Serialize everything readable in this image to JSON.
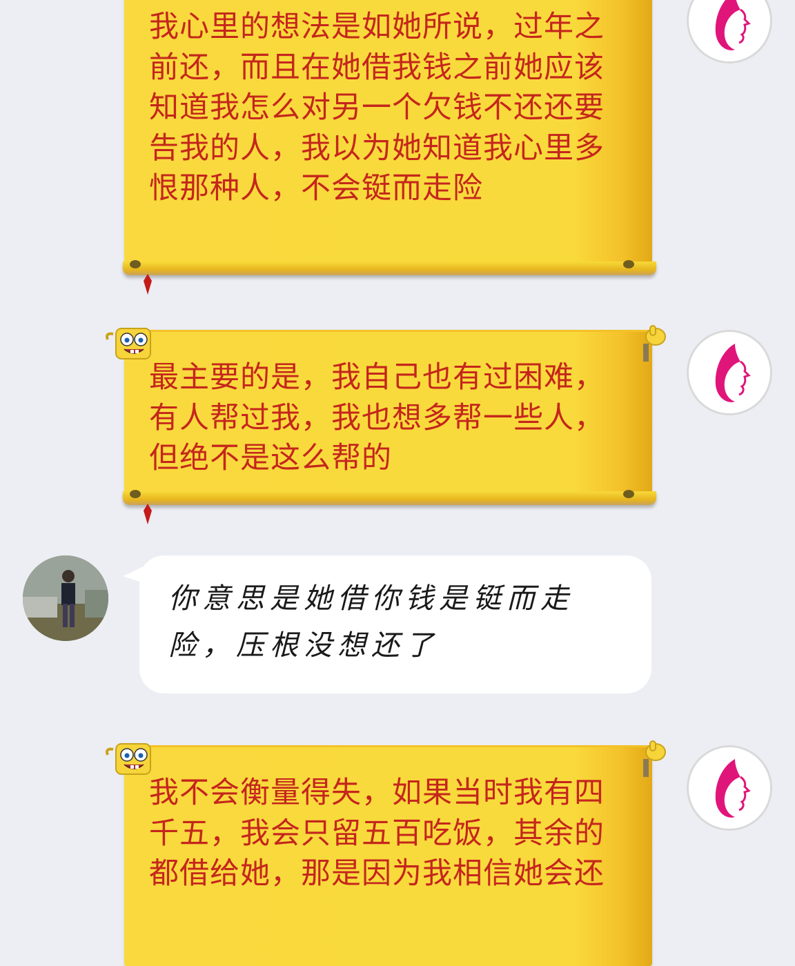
{
  "chat": {
    "messages": [
      {
        "sender": "self",
        "text": "我心里的想法是如她所说，过年之前还，而且在她借我钱之前她应该知道我怎么对另一个欠钱不还还要告我的人，我以为她知道我心里多恨那种人，不会铤而走险"
      },
      {
        "sender": "self",
        "text": "最主要的是，我自己也有过困难，有人帮过我，我也想多帮一些人，但绝不是这么帮的"
      },
      {
        "sender": "other",
        "text": "你意思是她借你钱是铤而走险，压根没想还了"
      },
      {
        "sender": "self",
        "text": "我不会衡量得失，如果当时我有四千五，我会只留五百吃饭，其余的都借给她，那是因为我相信她会还"
      }
    ]
  },
  "colors": {
    "background": "#eceef3",
    "scroll_yellow": "#f9d93d",
    "scroll_text": "#c4261c",
    "brand_pink": "#e0157a",
    "bubble_white": "#ffffff"
  },
  "icons": {
    "self_avatar": "brand-face-logo-icon",
    "other_avatar": "person-photo-avatar",
    "scroll_decoration": "sponge-character-icon",
    "scroll_corner": "thumbs-up-icon"
  }
}
